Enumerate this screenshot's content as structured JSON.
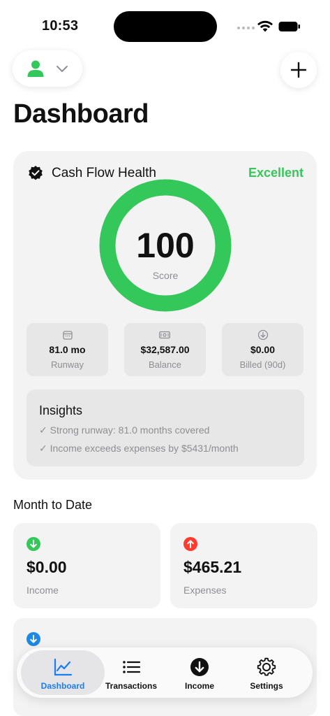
{
  "status_bar": {
    "time": "10:53"
  },
  "header": {
    "title": "Dashboard"
  },
  "health": {
    "title": "Cash Flow Health",
    "status": "Excellent",
    "score": "100",
    "score_label": "Score",
    "score_fraction": 1.0,
    "stats": [
      {
        "icon": "calendar-icon",
        "value": "81.0 mo",
        "label": "Runway"
      },
      {
        "icon": "banknote-icon",
        "value": "$32,587.00",
        "label": "Balance"
      },
      {
        "icon": "arrow-down-circle-icon",
        "value": "$0.00",
        "label": "Billed (90d)"
      }
    ],
    "insights_title": "Insights",
    "insights": [
      "✓ Strong runway: 81.0 months covered",
      "✓ Income exceeds expenses by $5431/month"
    ]
  },
  "month_to_date": {
    "title": "Month to Date",
    "income": {
      "value": "$0.00",
      "label": "Income"
    },
    "expenses": {
      "value": "$465.21",
      "label": "Expenses"
    }
  },
  "tabs": [
    {
      "label": "Dashboard",
      "icon": "chart-line-icon",
      "active": true
    },
    {
      "label": "Transactions",
      "icon": "list-icon",
      "active": false
    },
    {
      "label": "Income",
      "icon": "arrow-down-circle-icon",
      "active": false
    },
    {
      "label": "Settings",
      "icon": "gear-icon",
      "active": false
    }
  ],
  "colors": {
    "accent": "#1a7cf5",
    "positive": "#34c759",
    "negative": "#ff3b30",
    "info": "#1e88e5",
    "muted": "#8e8e93",
    "card": "#f3f3f3"
  }
}
